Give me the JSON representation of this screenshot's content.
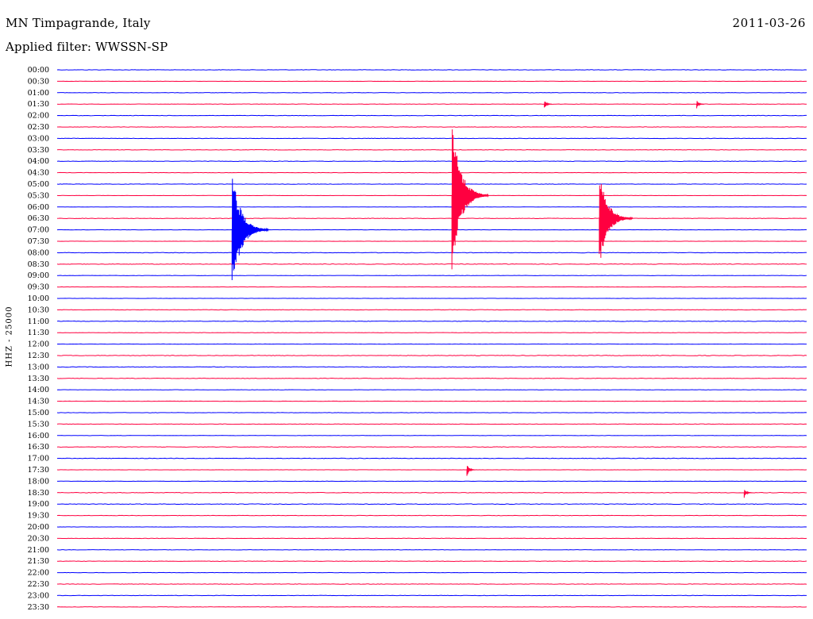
{
  "header": {
    "station": "MN Timpagrande, Italy",
    "date": "2011-03-26",
    "filter": "Applied filter: WWSSN-SP",
    "channel": "HHZ - 25000"
  },
  "colors": {
    "blue": "#0000ff",
    "red": "#ff0040",
    "text": "#000000",
    "background": "#ffffff"
  },
  "chart_data": {
    "type": "line",
    "title": "MN Timpagrande, Italy",
    "subtitle": "Applied filter: WWSSN-SP",
    "ylabel": "HHZ - 25000",
    "x_range_minutes": [
      0,
      30
    ],
    "rows": [
      "00:00",
      "00:30",
      "01:00",
      "01:30",
      "02:00",
      "02:30",
      "03:00",
      "03:30",
      "04:00",
      "04:30",
      "05:00",
      "05:30",
      "06:00",
      "06:30",
      "07:00",
      "07:30",
      "08:00",
      "08:30",
      "09:00",
      "09:30",
      "10:00",
      "10:30",
      "11:00",
      "11:30",
      "12:00",
      "12:30",
      "13:00",
      "13:30",
      "14:00",
      "14:30",
      "15:00",
      "15:30",
      "16:00",
      "16:30",
      "17:00",
      "17:30",
      "18:00",
      "18:30",
      "19:00",
      "19:30",
      "20:00",
      "20:30",
      "21:00",
      "21:30",
      "22:00",
      "22:30",
      "23:00",
      "23:30"
    ],
    "series_colors": [
      "blue",
      "red"
    ],
    "events": [
      {
        "row": "01:30",
        "minute": 19.5,
        "amplitude": 0.45
      },
      {
        "row": "01:30",
        "minute": 25.6,
        "amplitude": 0.4
      },
      {
        "row": "07:00",
        "minute": 7.0,
        "amplitude": 5.5
      },
      {
        "row": "05:30",
        "minute": 15.8,
        "amplitude": 7.0
      },
      {
        "row": "06:30",
        "minute": 21.7,
        "amplitude": 4.5
      },
      {
        "row": "17:30",
        "minute": 16.4,
        "amplitude": 0.6
      },
      {
        "row": "18:30",
        "minute": 27.5,
        "amplitude": 0.45
      }
    ]
  }
}
